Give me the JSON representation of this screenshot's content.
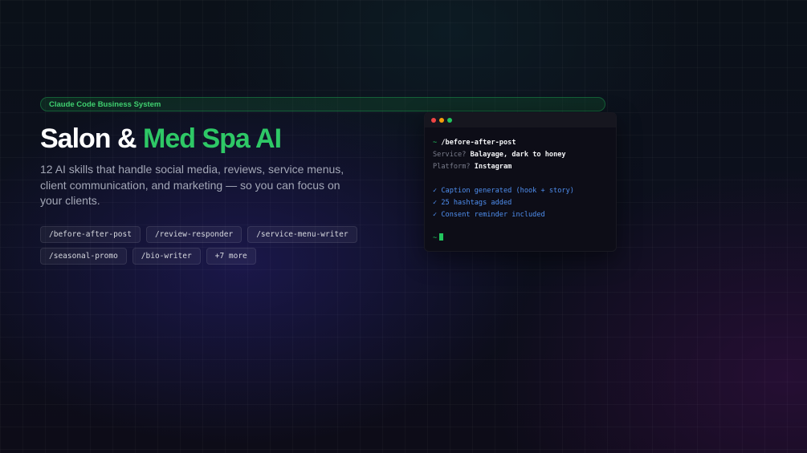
{
  "badge": {
    "label": "Claude Code Business System"
  },
  "hero": {
    "title_plain": "Salon & ",
    "title_accent": "Med Spa AI",
    "description": "12 AI skills that handle social media, reviews, service menus, client communication, and marketing — so you can focus on your clients."
  },
  "skills": [
    "/before-after-post",
    "/review-responder",
    "/service-menu-writer",
    "/seasonal-promo",
    "/bio-writer",
    "+7 more"
  ],
  "terminal": {
    "prompt_symbol": "~",
    "command": "/before-after-post",
    "fields": [
      {
        "label": "Service?",
        "value": "Balayage, dark to honey"
      },
      {
        "label": "Platform?",
        "value": "Instagram"
      }
    ],
    "results": [
      "✓ Caption generated (hook + story)",
      "✓ 25 hashtags added",
      "✓ Consent reminder included"
    ]
  },
  "colors": {
    "accent_green": "#2ec866",
    "result_blue": "#4f8ff0",
    "background": "#0c0f1d"
  }
}
